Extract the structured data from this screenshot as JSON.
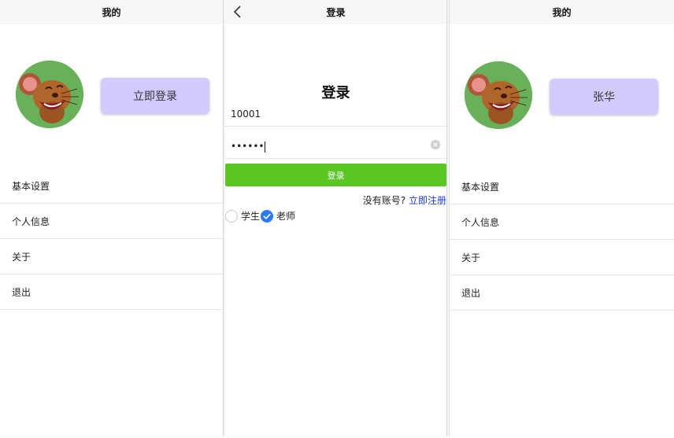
{
  "panels": [
    {
      "navbar": {
        "title": "我的"
      },
      "login_button_label": "立即登录",
      "menu": [
        "基本设置",
        "个人信息",
        "关于",
        "退出"
      ]
    },
    {
      "navbar": {
        "title": "登录"
      },
      "heading": "登录",
      "username_value": "10001",
      "password_mask": "••••••",
      "submit_label": "登录",
      "register_prompt": "没有账号?",
      "register_link": "立即注册",
      "role_options": [
        {
          "label": "学生",
          "selected": false
        },
        {
          "label": "老师",
          "selected": true
        }
      ]
    },
    {
      "navbar": {
        "title": "我的"
      },
      "user_name": "张华",
      "menu": [
        "基本设置",
        "个人信息",
        "关于",
        "退出"
      ]
    }
  ],
  "colors": {
    "navbar_bg": "#f7f7f7",
    "login_button_bg": "#d3cbff",
    "submit_bg": "#5ac725",
    "link": "#1a3be0",
    "radio_selected": "#2979ff",
    "avatar_bg": "#69b05a"
  },
  "icons": {
    "back": "chevron-left-icon",
    "clear": "clear-icon",
    "check": "check-icon",
    "avatar": "cartoon-mouse-avatar"
  }
}
